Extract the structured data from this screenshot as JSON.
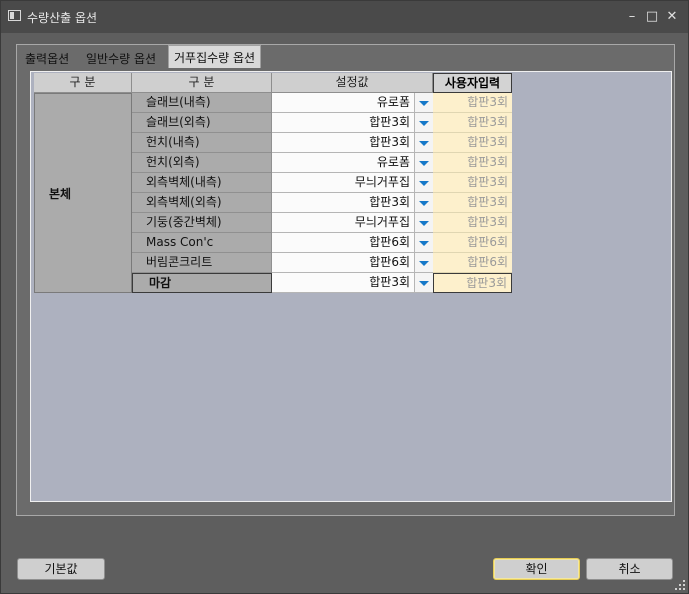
{
  "window": {
    "title": "수량산출 옵션"
  },
  "tabs": [
    {
      "label": "출력옵션"
    },
    {
      "label": "일반수량 옵션"
    },
    {
      "label": "거푸집수량 옵션"
    }
  ],
  "grid": {
    "headers": [
      "구 분",
      "구 분",
      "설정값",
      "사용자입력"
    ],
    "category": "본체",
    "rows": [
      {
        "label": "슬래브(내측)",
        "value": "유로폼",
        "user": "합판3회"
      },
      {
        "label": "슬래브(외측)",
        "value": "합판3회",
        "user": "합판3회"
      },
      {
        "label": "헌치(내측)",
        "value": "합판3회",
        "user": "합판3회"
      },
      {
        "label": "헌치(외측)",
        "value": "유로폼",
        "user": "합판3회"
      },
      {
        "label": "외측벽체(내측)",
        "value": "무늬거푸집",
        "user": "합판3회"
      },
      {
        "label": "외측벽체(외측)",
        "value": "합판3회",
        "user": "합판3회"
      },
      {
        "label": "기둥(중간벽체)",
        "value": "무늬거푸집",
        "user": "합판3회"
      },
      {
        "label": "Mass Con'c",
        "value": "합판6회",
        "user": "합판6회"
      },
      {
        "label": "버림콘크리트",
        "value": "합판6회",
        "user": "합판6회"
      },
      {
        "label": "마감",
        "value": "합판3회",
        "user": "합판3회"
      }
    ]
  },
  "buttons": {
    "default": "기본값",
    "ok": "확인",
    "cancel": "취소"
  },
  "titlebar_icons": {
    "minimize": "minimize-icon",
    "maximize": "maximize-icon",
    "close": "close-icon"
  },
  "colors": {
    "user_input_bg": "#fdf0cc",
    "dropdown_arrow": "#1478c8",
    "grid_bg": "#adb1bf"
  }
}
